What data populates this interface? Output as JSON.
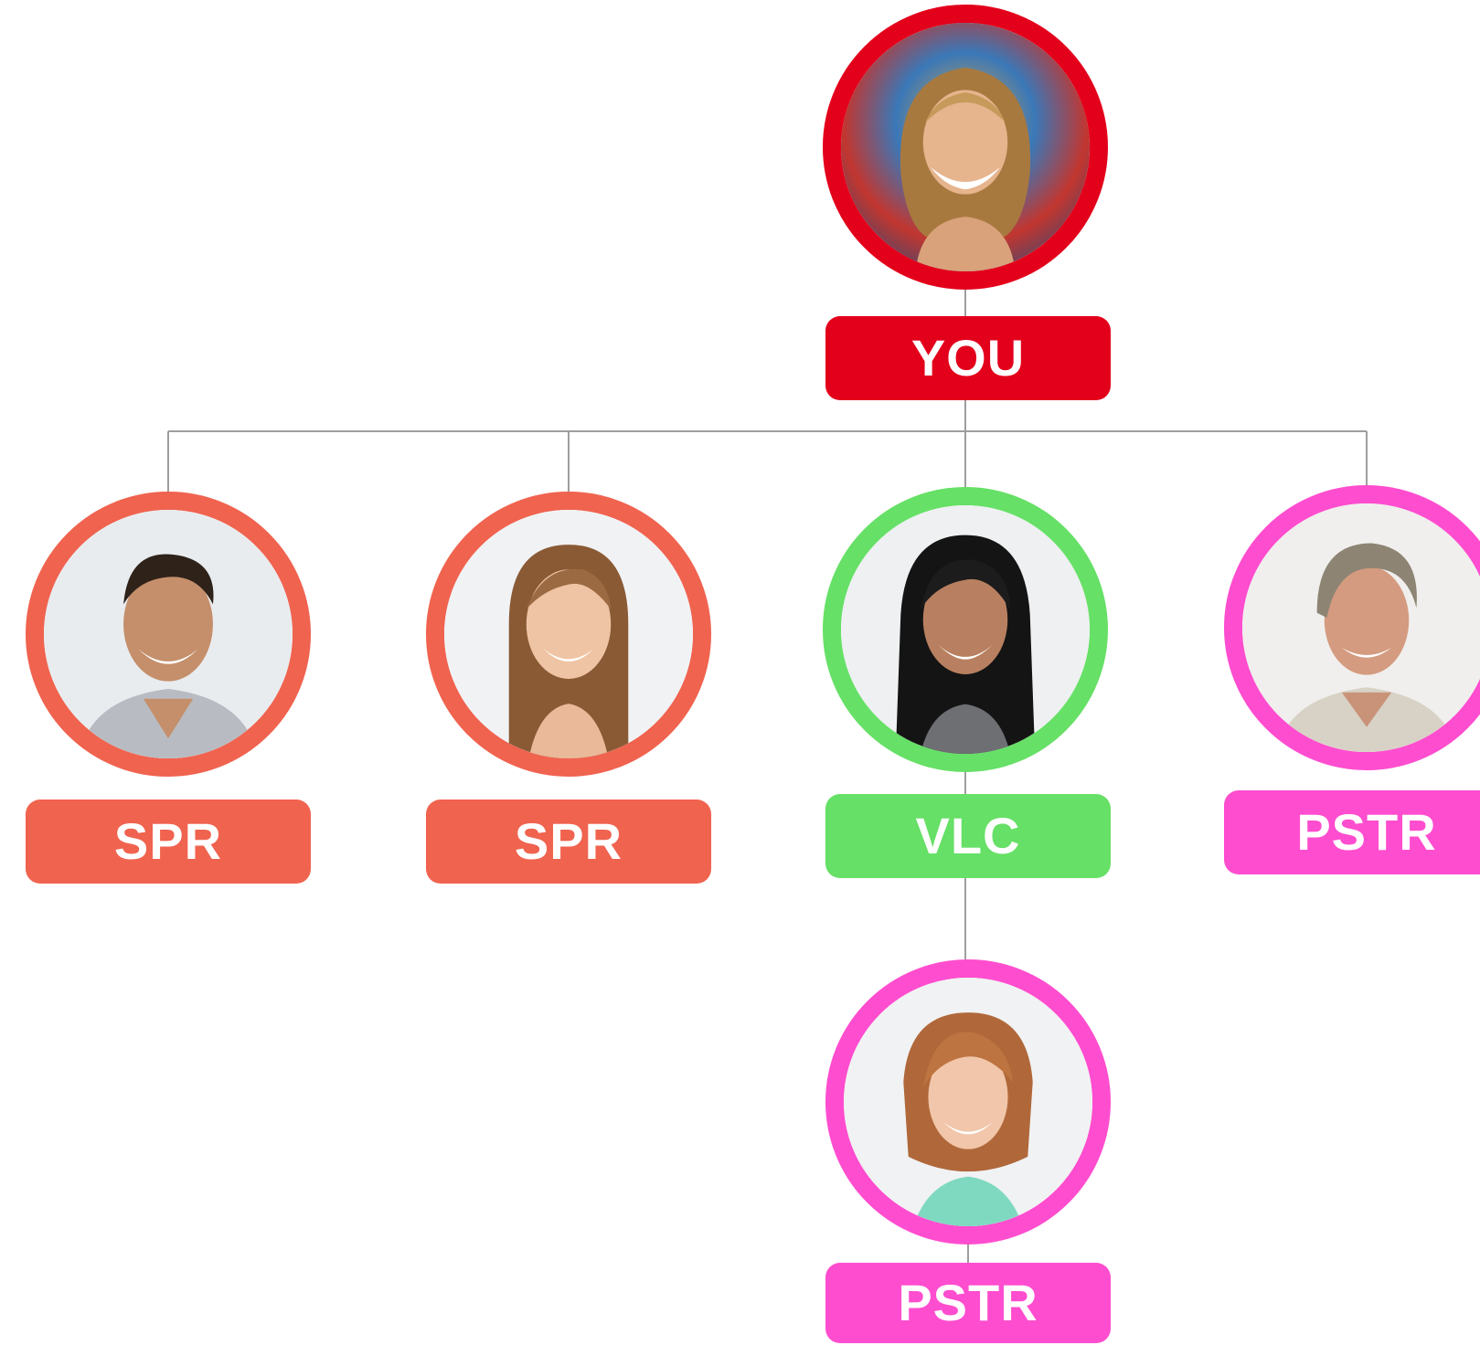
{
  "diagram": {
    "connector_color": "#9e9e9e",
    "nodes": [
      {
        "id": "root",
        "label": "YOU",
        "color": "#e3001b",
        "avatar_icon": "woman-curly-hair-portrait",
        "parent": null
      },
      {
        "id": "child-1",
        "label": "SPR",
        "color": "#f0634f",
        "avatar_icon": "young-man-portrait",
        "parent": "root"
      },
      {
        "id": "child-2",
        "label": "SPR",
        "color": "#f0634f",
        "avatar_icon": "woman-long-brown-hair-portrait",
        "parent": "root"
      },
      {
        "id": "child-3",
        "label": "VLC",
        "color": "#66e066",
        "avatar_icon": "woman-dark-hair-portrait",
        "parent": "root"
      },
      {
        "id": "child-4",
        "label": "PSTR",
        "color": "#ff4dcf",
        "avatar_icon": "older-man-portrait",
        "parent": "root"
      },
      {
        "id": "grandchild-1",
        "label": "PSTR",
        "color": "#ff4dcf",
        "avatar_icon": "woman-auburn-bob-portrait",
        "parent": "child-3"
      }
    ]
  }
}
